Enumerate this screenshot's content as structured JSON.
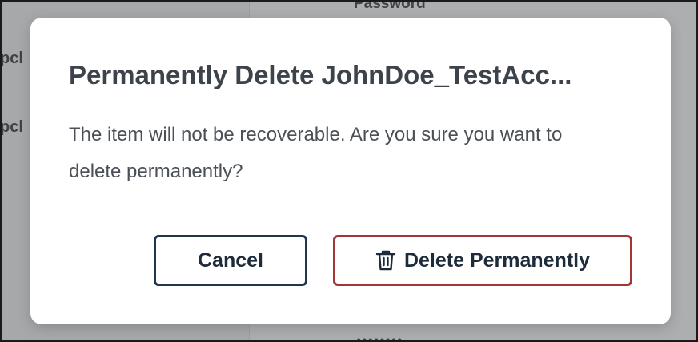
{
  "background": {
    "password_label": "Password",
    "left_fragment_1": "pcl",
    "left_fragment_2": "pcl",
    "dots": "••••••••"
  },
  "dialog": {
    "title": "Permanently Delete JohnDoe_TestAcc...",
    "body": "The item will not be recoverable. Are you sure you want to delete permanently?",
    "cancel_label": "Cancel",
    "delete_label": "Delete Permanently",
    "delete_icon": "trash-icon"
  },
  "colors": {
    "cancel_border": "#1f3550",
    "delete_border": "#a33535",
    "title_text": "#3d434a"
  }
}
